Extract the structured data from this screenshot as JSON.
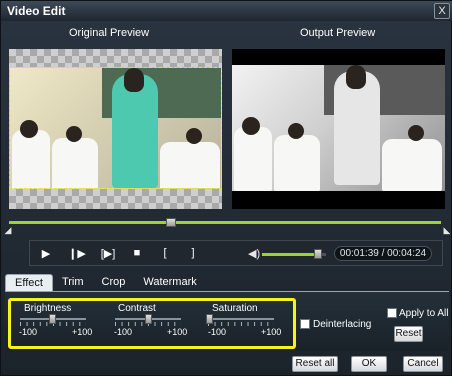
{
  "window": {
    "title": "Video Edit",
    "close_glyph": "X"
  },
  "previews": {
    "original_label": "Original Preview",
    "output_label": "Output Preview"
  },
  "playback": {
    "time": "00:01:39 / 00:04:24",
    "timeline_progress": 0.375,
    "volume_level": 0.85,
    "icons": [
      "play-icon",
      "next-frame-icon",
      "snapshot-icon",
      "stop-icon",
      "set-start-icon",
      "set-end-icon",
      "volume-icon"
    ]
  },
  "tabs": [
    {
      "label": "Effect",
      "active": true
    },
    {
      "label": "Trim",
      "active": false
    },
    {
      "label": "Crop",
      "active": false
    },
    {
      "label": "Watermark",
      "active": false
    }
  ],
  "effect": {
    "sliders": [
      {
        "label": "Brightness",
        "min": "-100",
        "max": "+100",
        "value": 0
      },
      {
        "label": "Contrast",
        "min": "-100",
        "max": "+100",
        "value": 0
      },
      {
        "label": "Saturation",
        "min": "-100",
        "max": "+100",
        "value": -100
      }
    ],
    "deinterlacing_label": "Deinterlacing",
    "deinterlacing_checked": false,
    "apply_to_all_label": "Apply to All",
    "apply_to_all_checked": false,
    "reset_label": "Reset"
  },
  "footer": {
    "reset_all_label": "Reset all",
    "ok_label": "OK",
    "cancel_label": "Cancel"
  },
  "colors": {
    "accent_green": "#9bd13a",
    "highlight_yellow": "#f5f518"
  }
}
